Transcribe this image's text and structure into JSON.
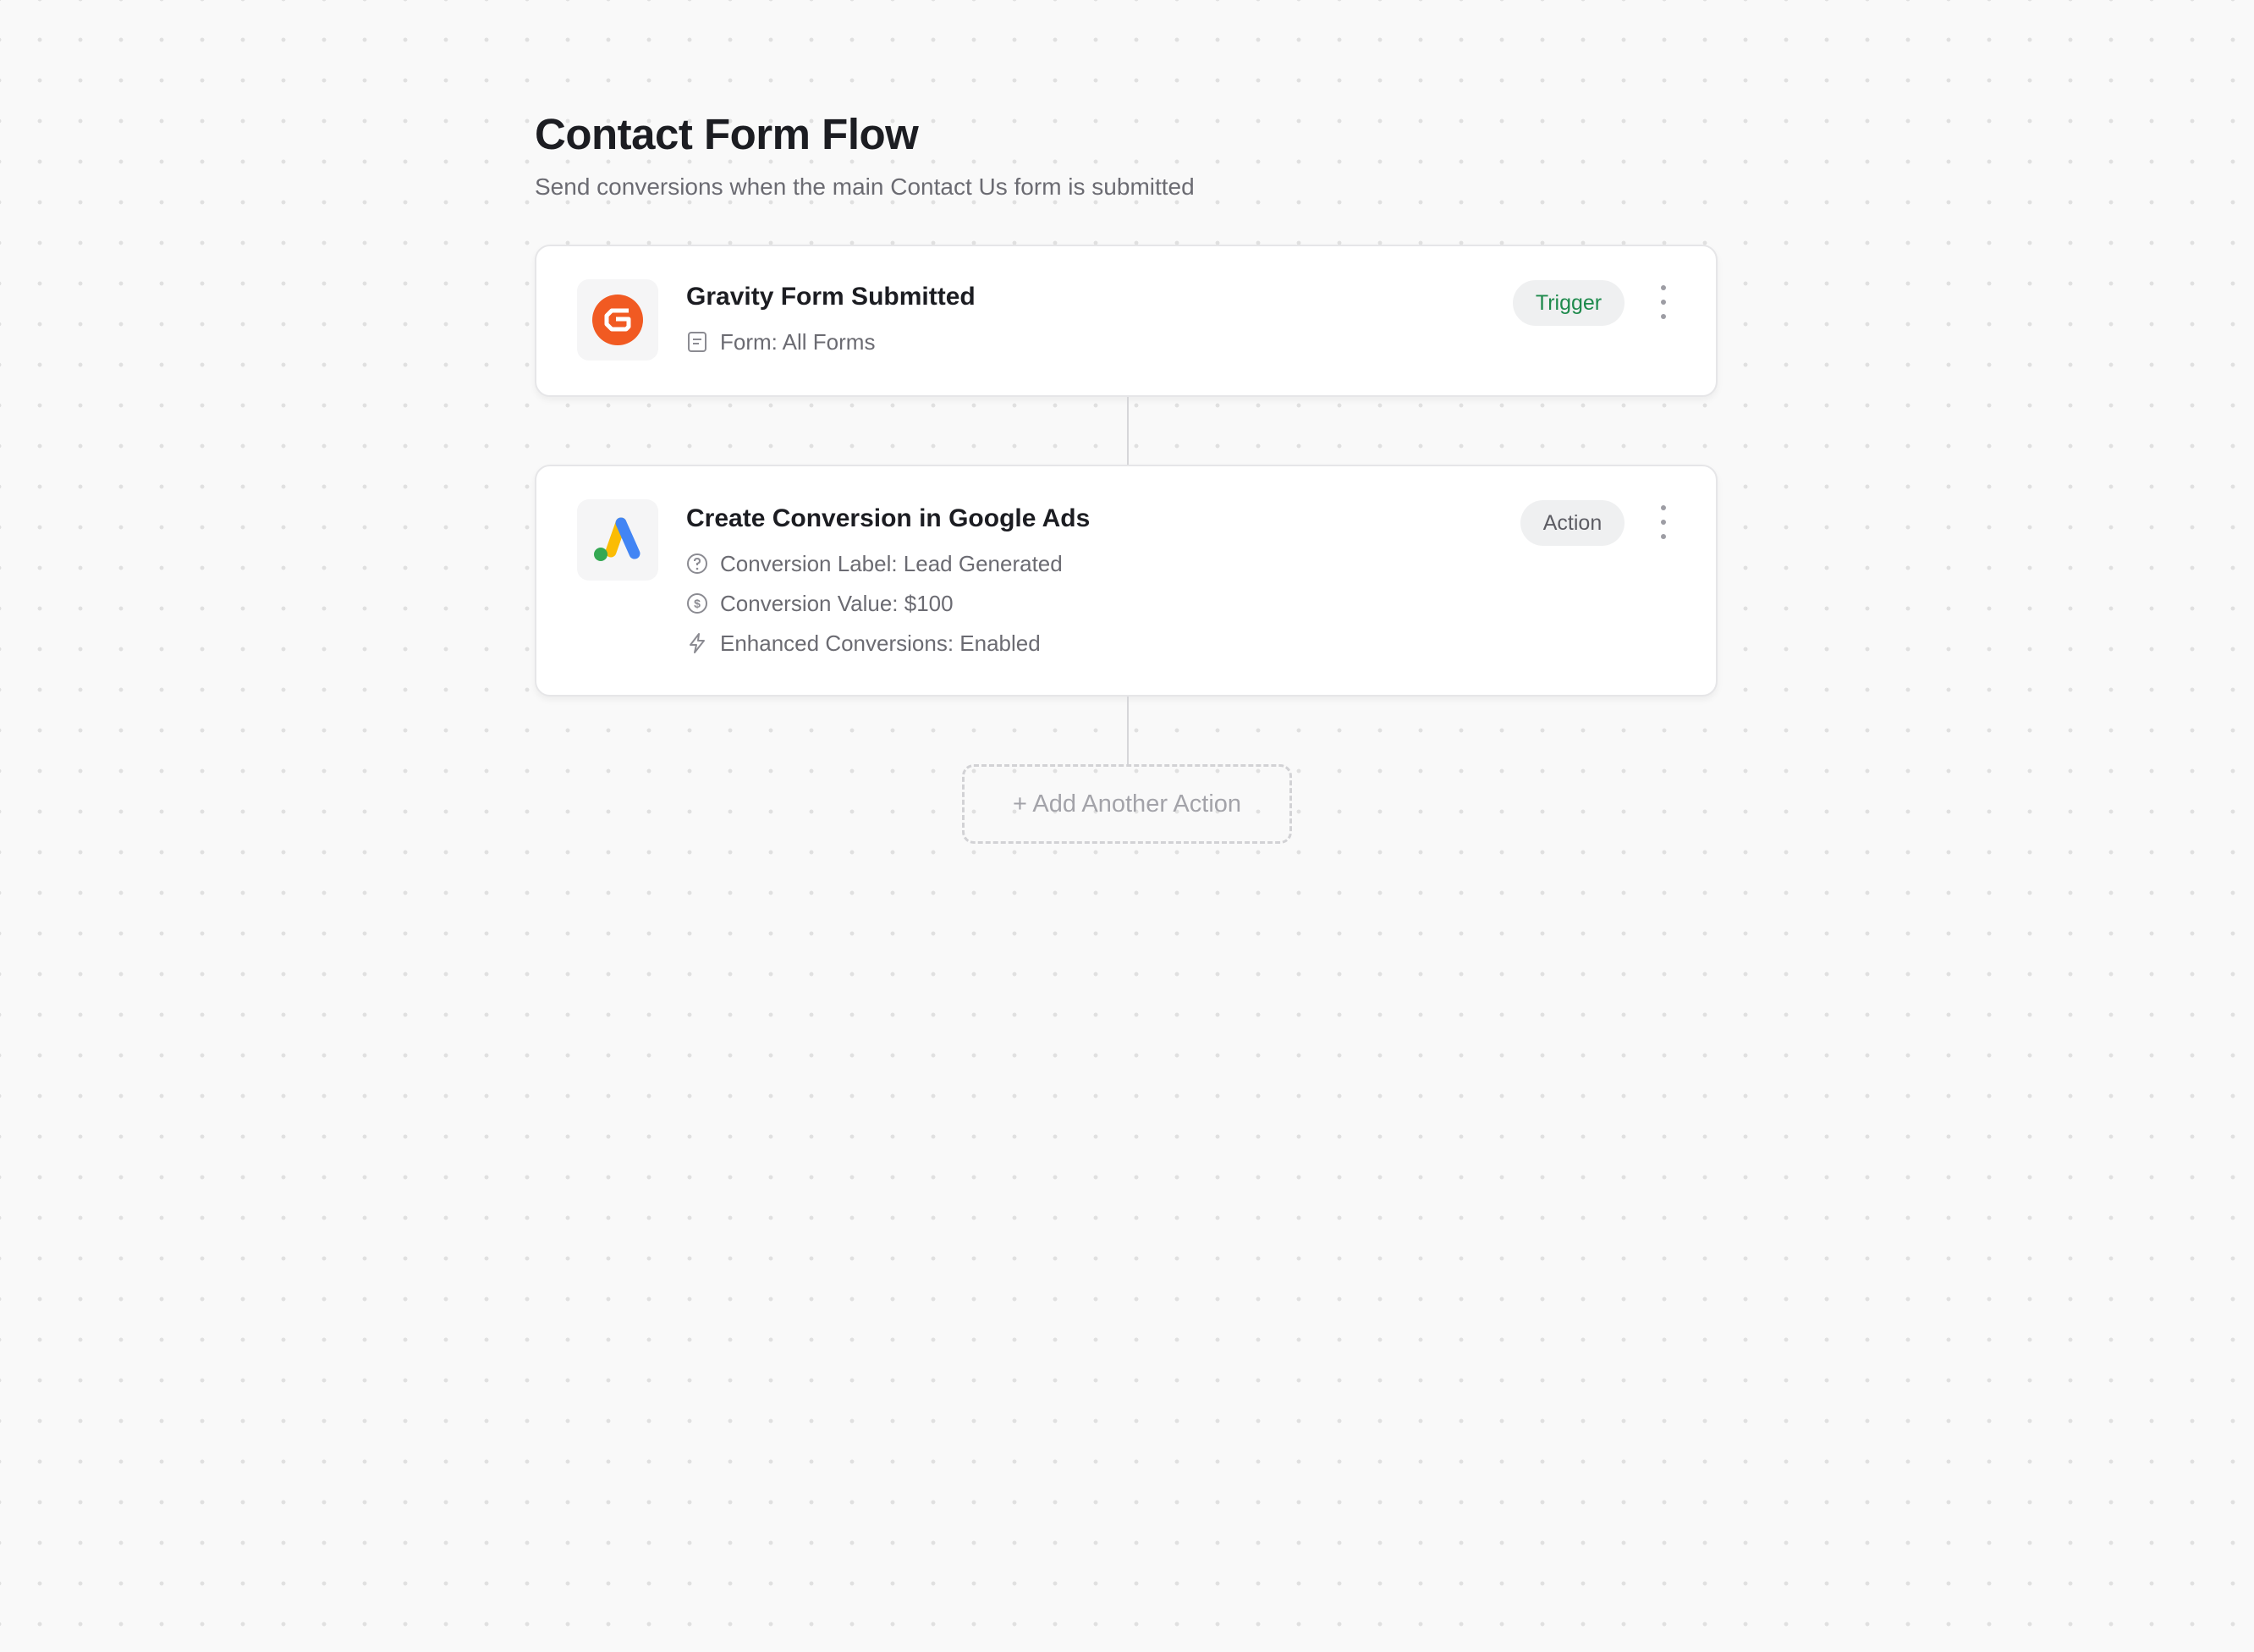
{
  "flow": {
    "title": "Contact Form Flow",
    "subtitle": "Send conversions when the main Contact Us form is submitted"
  },
  "trigger": {
    "title": "Gravity Form Submitted",
    "badge": "Trigger",
    "logo_icon": "gravity-forms-logo",
    "details": [
      {
        "icon": "form-icon",
        "text": "Form: All Forms"
      }
    ]
  },
  "action": {
    "title": "Create Conversion in Google Ads",
    "badge": "Action",
    "logo_icon": "google-ads-logo",
    "details": [
      {
        "icon": "tag-icon",
        "text": "Conversion Label: Lead Generated"
      },
      {
        "icon": "dollar-icon",
        "text": "Conversion Value: $100"
      },
      {
        "icon": "lightning-icon",
        "text": "Enhanced Conversions: Enabled"
      }
    ]
  },
  "add_action": {
    "label": "+ Add Another Action"
  },
  "colors": {
    "trigger_badge_text": "#1e8a4c",
    "gravity_orange": "#f15a22",
    "google_blue": "#4285f4",
    "google_yellow": "#fbbc04",
    "google_green": "#34a853"
  }
}
